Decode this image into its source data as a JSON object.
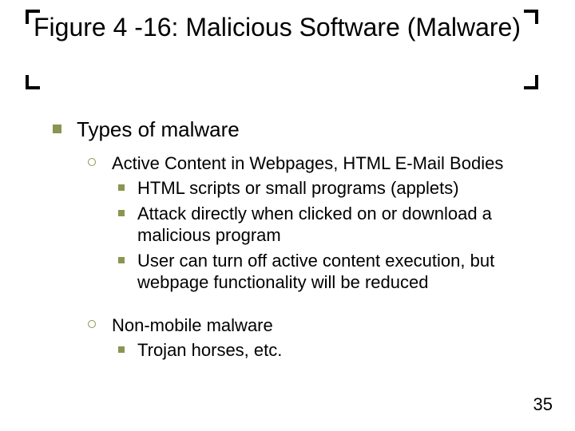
{
  "title": "Figure 4 -16: Malicious Software (Malware)",
  "bullets": {
    "lvl1": "Types of malware",
    "group1": {
      "lvl2": "Active Content in Webpages, HTML E-Mail Bodies",
      "sub": [
        "HTML scripts or small programs (applets)",
        "Attack directly when clicked on or download a malicious program",
        "User can turn off active content execution, but webpage functionality will be reduced"
      ]
    },
    "group2": {
      "lvl2": "Non-mobile malware",
      "sub": [
        "Trojan horses, etc."
      ]
    }
  },
  "page_number": "35"
}
